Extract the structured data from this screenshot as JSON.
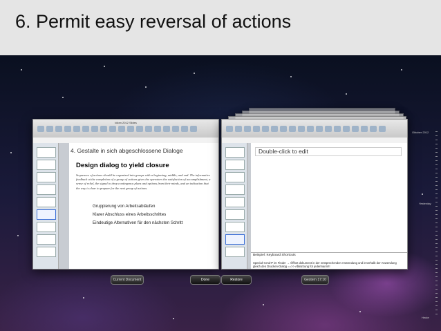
{
  "slide": {
    "title": "6. Permit easy reversal of actions"
  },
  "left_window": {
    "title": "Idiom 2012 Slides",
    "slide_heading": "4. Gestalte in sich abgeschlossene Dialoge",
    "design_heading": "Design dialog to yield closure",
    "body_text": "Sequences of actions should be organized into groups with a beginning, middle, and end. The informative feedback at the completion of a group of actions gives the operators the satisfaction of accomplishment, a sense of relief, the signal to drop contingency plans and options from their minds, and an indication that the way is clear to prepare for the next group of actions.",
    "bullets": [
      "Gruppierung von Arbeitsabläufen",
      "Klarer Abschluss eines Arbeitsschrittes",
      "Eindeutige Alternativen für den nächsten Schritt"
    ]
  },
  "right_window": {
    "edit_hint": "Double-click to edit",
    "notes_label": "Beispiel: Keyboard Shortcuts",
    "notes_text": "Spezial! Cmd-P im Finder → Öffnet dokument in der entsprechenden Anwendung und innerhalb der Anwendung gleich den Drucken-Dialog ==>> Abkürzung für jedermann!!!"
  },
  "bottom_bar": {
    "current_document": "Current Document",
    "done": "Done",
    "restore": "Restore",
    "timestamp": "Gestern 17:10"
  },
  "timeline": {
    "top_label": "Oktober 2012",
    "mid_label": "Yesterday",
    "bottom_label": "Heute"
  }
}
